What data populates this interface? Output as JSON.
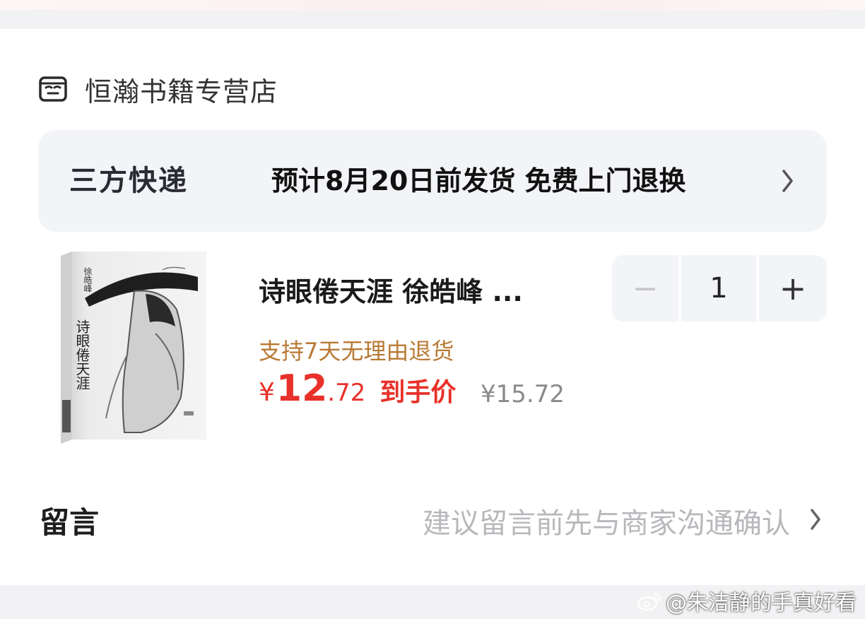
{
  "store": {
    "name": "恒瀚书籍专营店",
    "icon": "store-face-icon"
  },
  "shipping": {
    "type": "三方快递",
    "info": "预计8月20日前发货 免费上门退换",
    "arrow_icon": "chevron-right-icon"
  },
  "product": {
    "title": "诗眼倦天涯 徐皓峰 ...",
    "cover_author": "徐皓峰",
    "cover_title": "诗眼倦天涯",
    "return_policy": "支持7天无理由退货",
    "price": {
      "currency": "¥",
      "integer": "12",
      "decimal": ".72",
      "tag": "到手价",
      "original": "¥15.72"
    },
    "quantity": {
      "minus": "−",
      "value": "1",
      "plus": "+"
    }
  },
  "note": {
    "label": "留言",
    "hint": "建议留言前先与商家沟通确认"
  },
  "watermark": {
    "text": "@朱洁静的手真好看",
    "icon": "weibo-icon"
  },
  "colors": {
    "price_red": "#e8312a",
    "return_brown": "#b87a34",
    "panel_bg": "#f3f4f8",
    "hint_gray": "#b8b8bc"
  }
}
